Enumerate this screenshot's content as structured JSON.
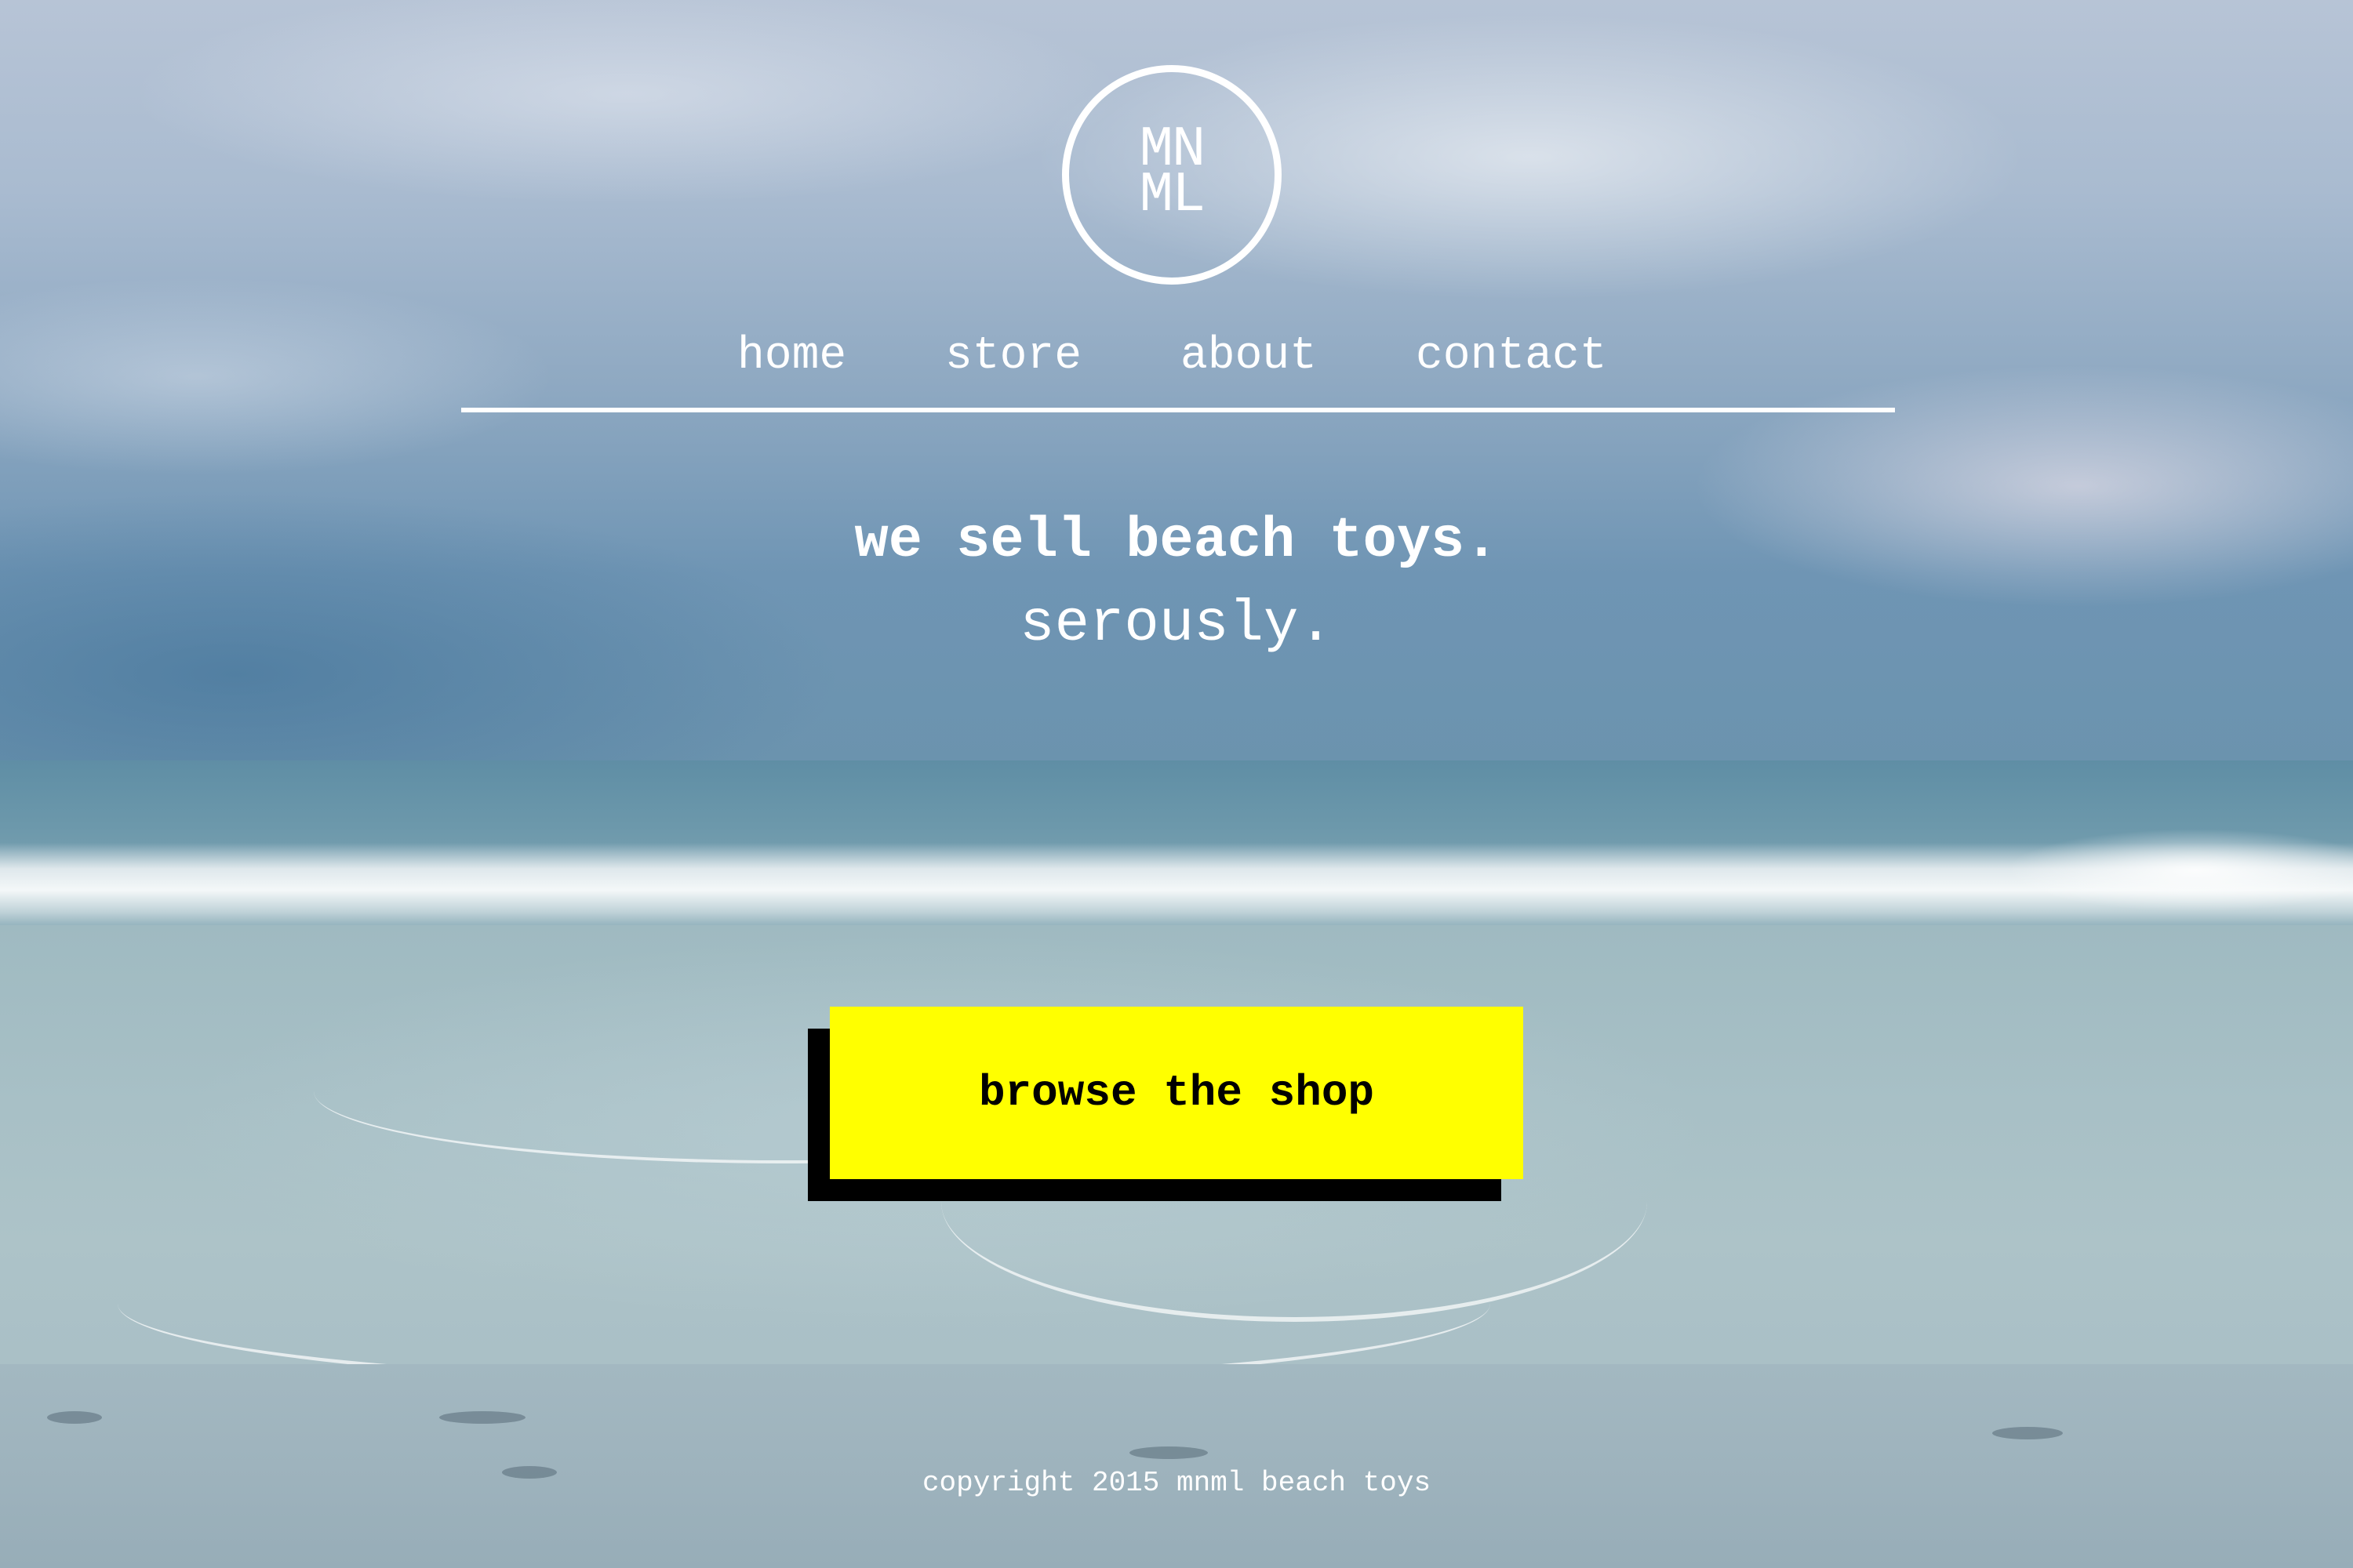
{
  "logo": {
    "line1": "MN",
    "line2": "ML"
  },
  "nav": {
    "items": [
      {
        "label": "home"
      },
      {
        "label": "store"
      },
      {
        "label": "about"
      },
      {
        "label": "contact"
      }
    ]
  },
  "hero": {
    "headline": "we sell beach toys.",
    "subline": "serously."
  },
  "cta": {
    "label": "browse the shop"
  },
  "footer": {
    "copyright": "copyright 2015 mnml beach toys"
  },
  "colors": {
    "cta_background": "#ffff00",
    "cta_shadow": "#000000",
    "text": "#ffffff"
  }
}
